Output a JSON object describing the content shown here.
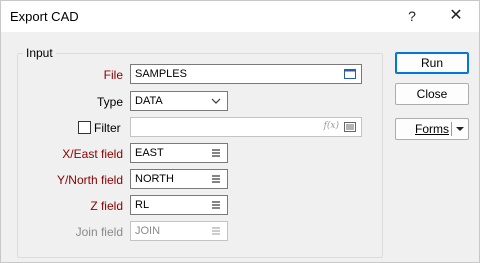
{
  "window": {
    "title": "Export CAD",
    "help_glyph": "?",
    "close_glyph": "✕"
  },
  "group": {
    "legend": "Input"
  },
  "fields": {
    "file": {
      "label": "File",
      "value": "SAMPLES"
    },
    "type": {
      "label": "Type",
      "value": "DATA"
    },
    "filter": {
      "label": "Filter",
      "value": "",
      "fx_glyph": "f(x)"
    },
    "x_east": {
      "label": "X/East field",
      "value": "EAST"
    },
    "y_north": {
      "label": "Y/North field",
      "value": "NORTH"
    },
    "z": {
      "label": "Z field",
      "value": "RL"
    },
    "join": {
      "label": "Join field",
      "value": "JOIN"
    }
  },
  "buttons": {
    "run": "Run",
    "close": "Close",
    "forms": "Forms"
  }
}
